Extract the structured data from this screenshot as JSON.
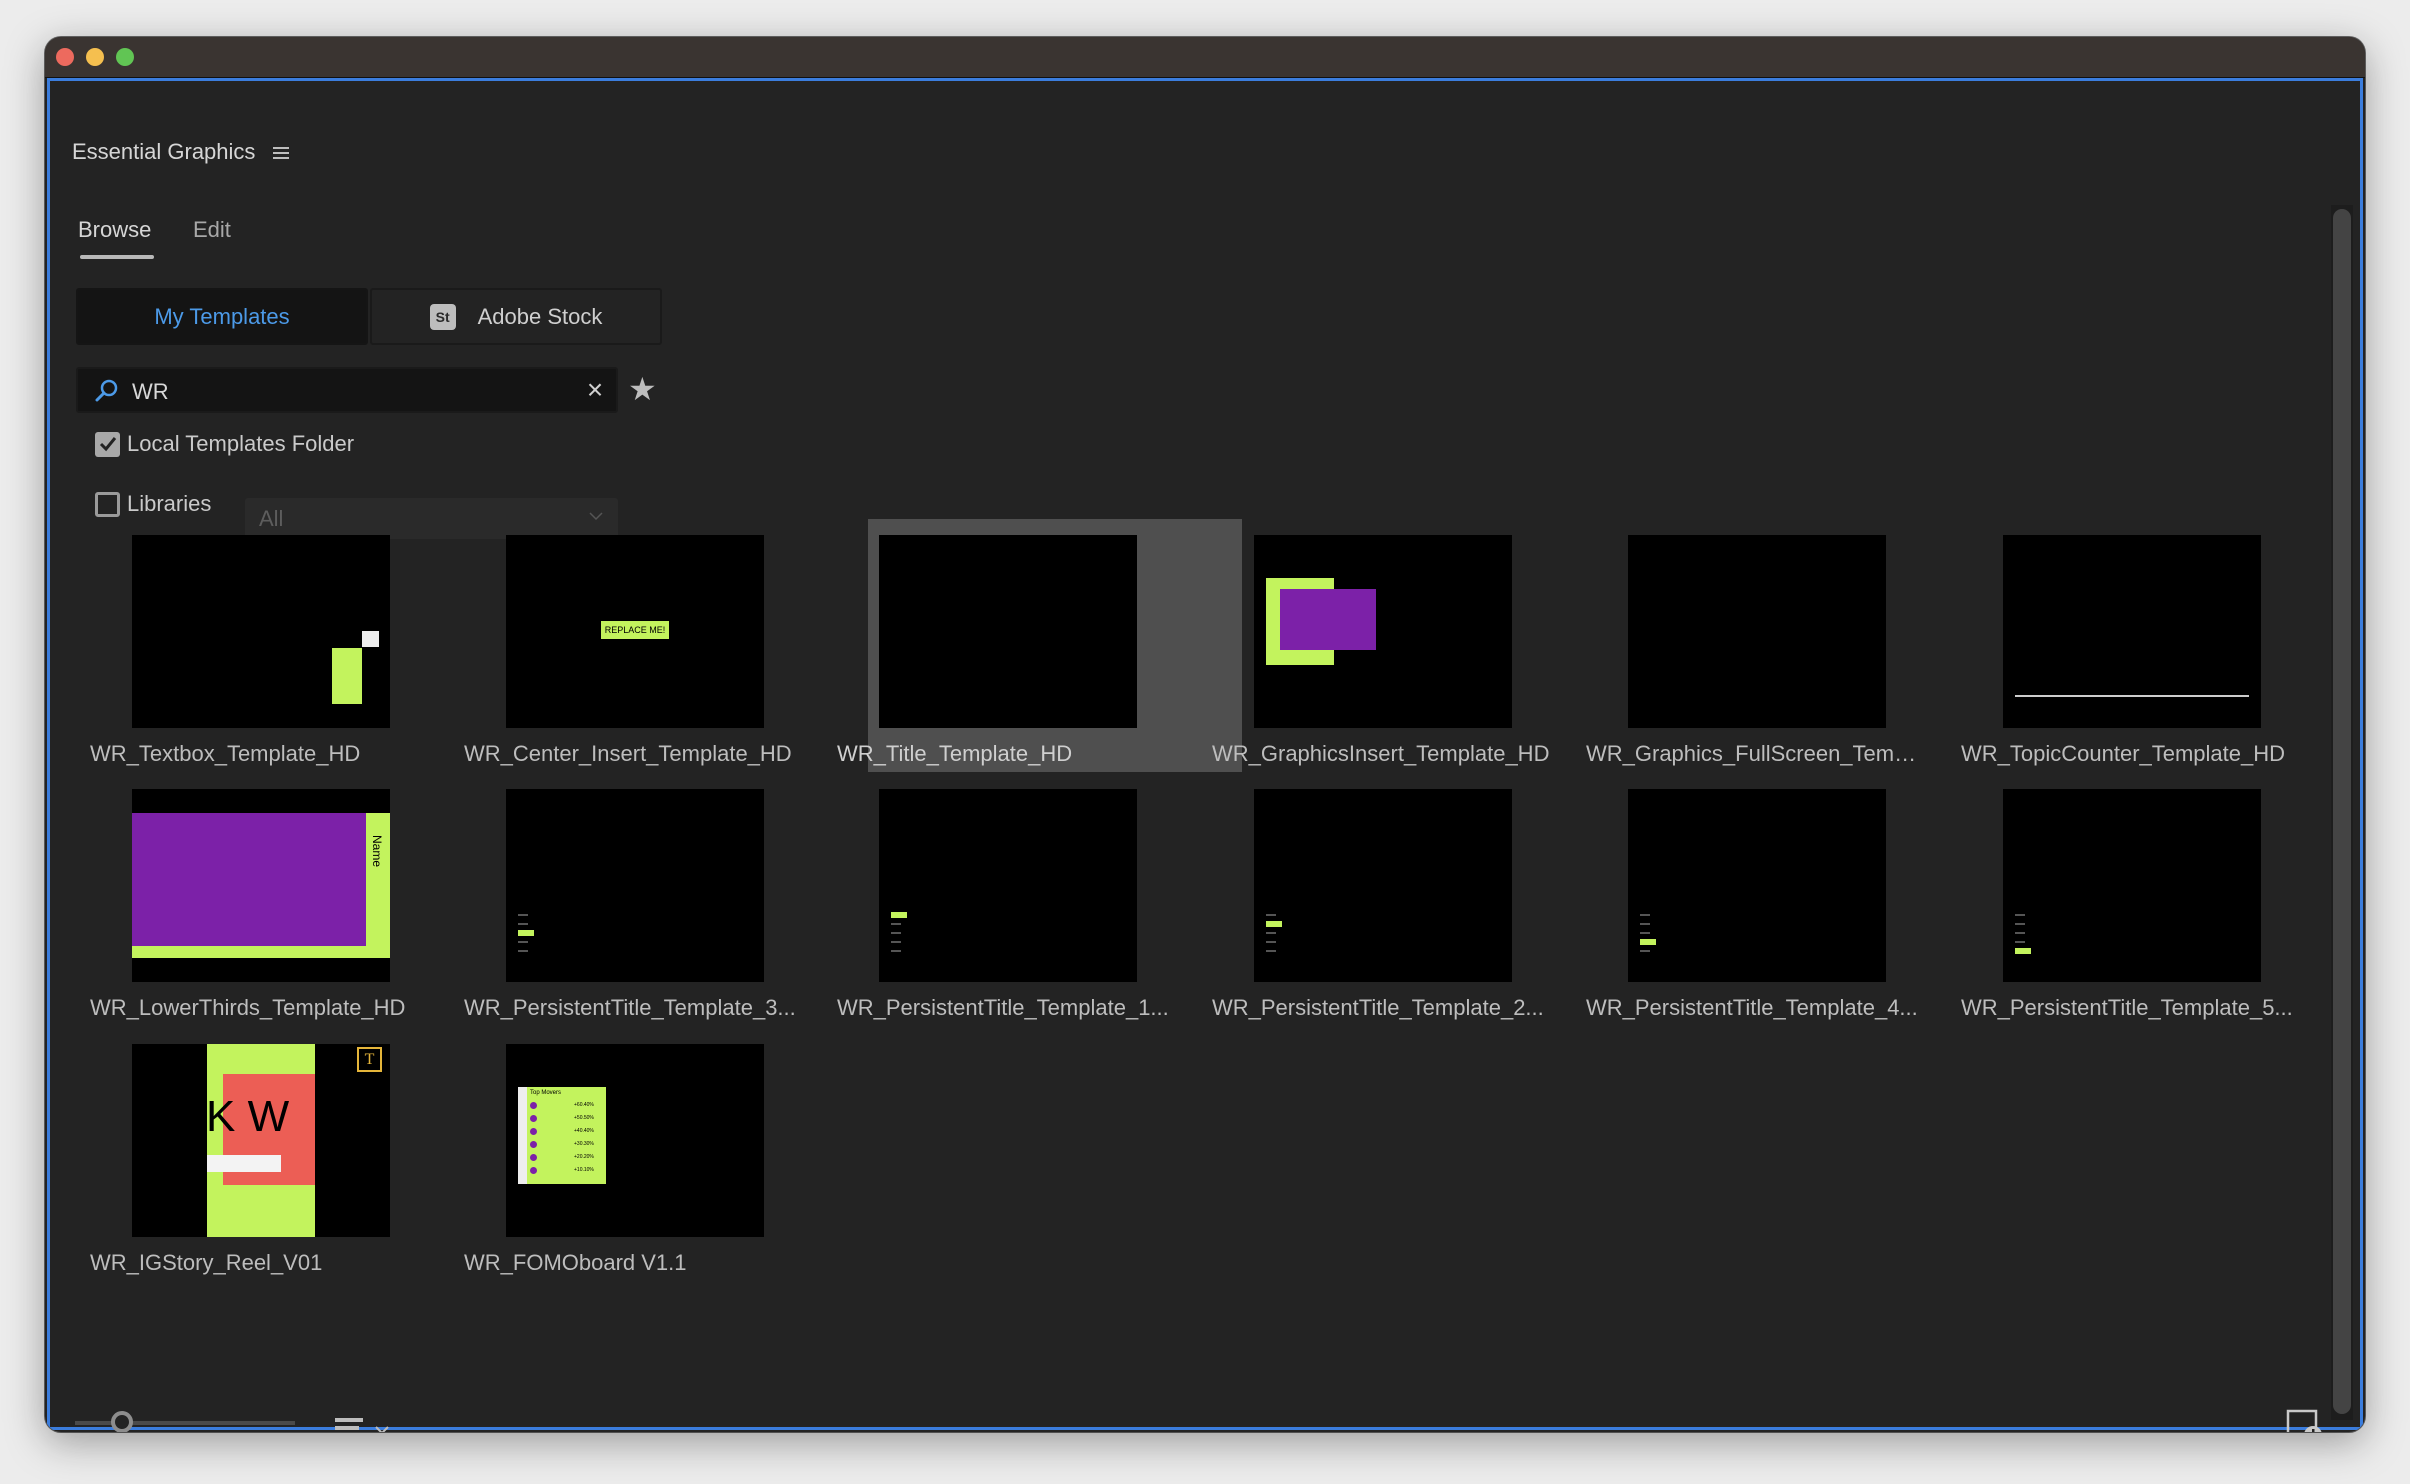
{
  "window": {
    "controls": [
      "close",
      "minimize",
      "zoom"
    ]
  },
  "panel": {
    "title": "Essential Graphics",
    "menu_icon": "hamburger-icon"
  },
  "tabs": [
    {
      "label": "Browse",
      "active": true
    },
    {
      "label": "Edit",
      "active": false
    }
  ],
  "source": {
    "my_templates": "My Templates",
    "adobe_stock": "Adobe Stock",
    "stock_badge": "St",
    "active": "My Templates"
  },
  "search": {
    "value": "WR",
    "clear_icon": "×",
    "favorite_icon": "★"
  },
  "filters": {
    "local": {
      "label": "Local Templates Folder",
      "checked": true
    },
    "libraries": {
      "label": "Libraries",
      "checked": false,
      "select_value": "All",
      "disabled": true
    }
  },
  "templates": [
    {
      "name": "WR_Textbox_Template_HD",
      "thumb": "textbox"
    },
    {
      "name": "WR_Center_Insert_Template_HD",
      "thumb": "center",
      "thumb_text": "REPLACE ME!"
    },
    {
      "name": "WR_Title_Template_HD",
      "thumb": "blank",
      "selected": true
    },
    {
      "name": "WR_GraphicsInsert_Template_HD",
      "thumb": "graphicsinsert"
    },
    {
      "name": "WR_Graphics_FullScreen_Templ...",
      "thumb": "blank"
    },
    {
      "name": "WR_TopicCounter_Template_HD",
      "thumb": "topiccounter"
    },
    {
      "name": "WR_LowerThirds_Template_HD",
      "thumb": "lowerthirds",
      "thumb_text": "Name"
    },
    {
      "name": "WR_PersistentTitle_Template_3...",
      "thumb": "persistent",
      "highlight": 3
    },
    {
      "name": "WR_PersistentTitle_Template_1...",
      "thumb": "persistent",
      "highlight": 1
    },
    {
      "name": "WR_PersistentTitle_Template_2...",
      "thumb": "persistent",
      "highlight": 2
    },
    {
      "name": "WR_PersistentTitle_Template_4...",
      "thumb": "persistent",
      "highlight": 4
    },
    {
      "name": "WR_PersistentTitle_Template_5...",
      "thumb": "persistent",
      "highlight": 5
    },
    {
      "name": "WR_IGStory_Reel_V01",
      "thumb": "igstory",
      "thumb_text": "K W",
      "warning_icon": "missing-font-warning"
    },
    {
      "name": "WR_FOMOboard V1.1",
      "thumb": "fomoboard",
      "thumb_text": "Top Movers",
      "rows": [
        "+60.40%",
        "+50.50%",
        "+40.40%",
        "+30.30%",
        "+20.20%",
        "+10.10%"
      ]
    }
  ],
  "footer": {
    "thumbnail_size": 0.18,
    "sort_icon": "sort-list-icon",
    "new_item_icon": "new-item-icon"
  },
  "colors": {
    "accent": "#3b7ddd",
    "active_text": "#4c9ae8",
    "lime": "#c3f35d",
    "purple": "#7c21a8",
    "coral": "#ec5e55"
  }
}
